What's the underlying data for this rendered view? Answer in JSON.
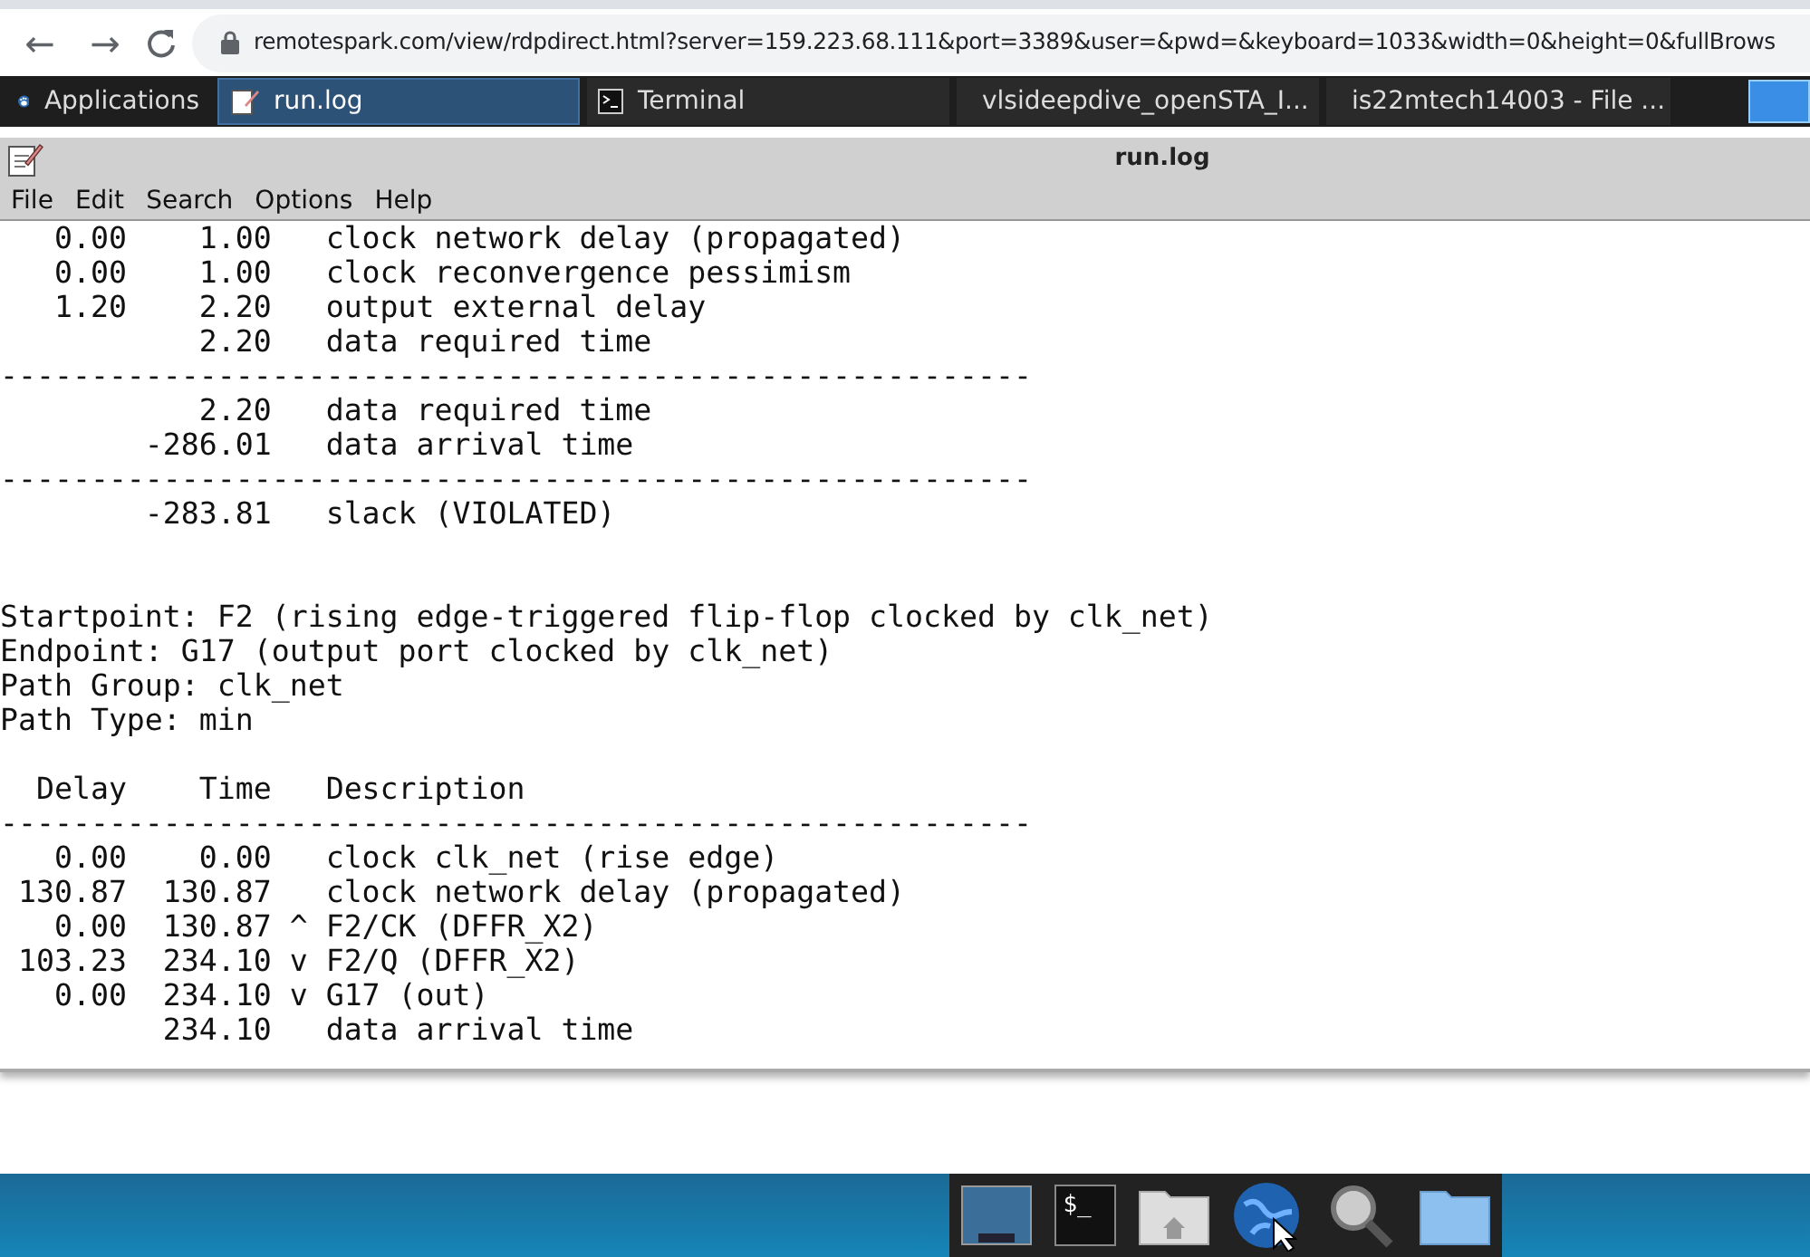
{
  "browser": {
    "url": "remotespark.com/view/rdpdirect.html?server=159.223.68.111&port=3389&user=&pwd=&keyboard=1033&width=0&height=0&fullBrows",
    "back": "←",
    "forward": "→"
  },
  "taskbar": {
    "items": [
      {
        "kind": "menu",
        "label": "Applications",
        "selected": false
      },
      {
        "kind": "editor",
        "label": "run.log",
        "selected": true
      },
      {
        "kind": "terminal",
        "label": "Terminal",
        "selected": false
      },
      {
        "kind": "folder",
        "label": "vlsideepdive_openSTA_I...",
        "selected": false
      },
      {
        "kind": "home",
        "label": "is22mtech14003 - File ...",
        "selected": false
      }
    ]
  },
  "window": {
    "title": "run.log",
    "menu": [
      "File",
      "Edit",
      "Search",
      "Options",
      "Help"
    ]
  },
  "log_lines": [
    "   0.00    1.00   clock network delay (propagated)",
    "   0.00    1.00   clock reconvergence pessimism",
    "   1.20    2.20   output external delay",
    "           2.20   data required time",
    "---------------------------------------------------------",
    "           2.20   data required time",
    "        -286.01   data arrival time",
    "---------------------------------------------------------",
    "        -283.81   slack (VIOLATED)",
    {
      "kind": "blank"
    },
    {
      "kind": "blank"
    },
    "Startpoint: F2 (rising edge-triggered flip-flop clocked by clk_net)",
    "Endpoint: G17 (output port clocked by clk_net)",
    "Path Group: clk_net",
    "Path Type: min",
    {
      "kind": "blank"
    },
    "  Delay    Time   Description",
    "---------------------------------------------------------",
    "   0.00    0.00   clock clk_net (rise edge)",
    " 130.87  130.87   clock network delay (propagated)",
    "   0.00  130.87 ^ F2/CK (DFFR_X2)",
    " 103.23  234.10 v F2/Q (DFFR_X2)",
    "   0.00  234.10 v G17 (out)",
    "         234.10   data arrival time"
  ],
  "dock": {
    "items": [
      {
        "kind": "desktop"
      },
      {
        "kind": "terminal",
        "glyph": "$_"
      },
      {
        "kind": "home"
      },
      {
        "kind": "web"
      },
      {
        "kind": "search"
      },
      {
        "kind": "folder"
      }
    ]
  }
}
